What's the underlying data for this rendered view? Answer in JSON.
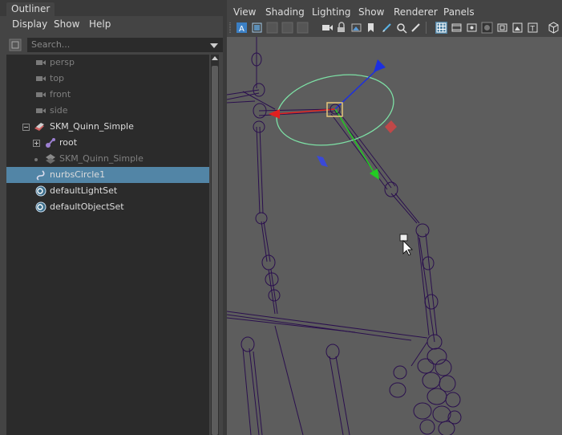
{
  "outliner": {
    "tab_title": "Outliner",
    "menus": [
      "Display",
      "Show",
      "Help"
    ],
    "search_placeholder": "Search...",
    "items": [
      {
        "label": "persp",
        "icon": "camera-icon"
      },
      {
        "label": "top",
        "icon": "camera-icon"
      },
      {
        "label": "front",
        "icon": "camera-icon"
      },
      {
        "label": "side",
        "icon": "camera-icon"
      },
      {
        "label": "SKM_Quinn_Simple",
        "icon": "group-icon"
      },
      {
        "label": "root",
        "icon": "joint-icon"
      },
      {
        "label": "SKM_Quinn_Simple",
        "icon": "mesh-icon"
      },
      {
        "label": "nurbsCircle1",
        "icon": "curve-icon"
      },
      {
        "label": "defaultLightSet",
        "icon": "set-icon"
      },
      {
        "label": "defaultObjectSet",
        "icon": "set-icon"
      }
    ]
  },
  "viewport": {
    "menus": [
      "View",
      "Shading",
      "Lighting",
      "Show",
      "Renderer",
      "Panels"
    ]
  },
  "colors": {
    "selection": "#5285a6",
    "wireframe": "#2a0f4e",
    "rotate_ring": "#7de0a5",
    "manip_handle": "#e6c77a",
    "axis_x": "#e02020",
    "axis_y": "#22cc22",
    "axis_z": "#1c2fe0"
  }
}
